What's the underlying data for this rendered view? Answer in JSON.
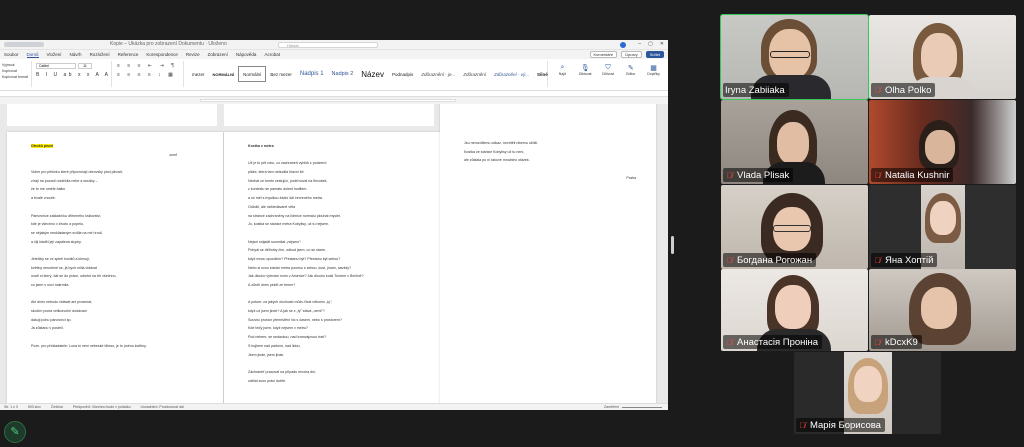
{
  "word": {
    "doc_title": "Kopie – Ukázka pro zobrazení Dokumentu · Uloženo",
    "search_placeholder": "Hledat",
    "window_controls": [
      "–",
      "▢",
      "✕"
    ],
    "tabs": [
      "Soubor",
      "Domů",
      "Vložení",
      "Návrh",
      "Rozložení",
      "Reference",
      "Korespondence",
      "Revize",
      "Zobrazení",
      "Nápověda",
      "Acrobat"
    ],
    "active_tab": "Domů",
    "right_pills": [
      "Komentáře",
      "Úpravy",
      "Sdílet"
    ],
    "clipboard": [
      "Vyjmout",
      "Kopírovat",
      "Kopírovat formát"
    ],
    "font_name": "Calibri",
    "font_size": "11",
    "styles": [
      "mezer",
      "NORMÁLNÍ",
      "Normální",
      "Bez mezer",
      "Nadpis 1",
      "Nadpis 2",
      "Název",
      "Podnadpis",
      "Zdůraznění - je...",
      "Zdůraznění",
      "Zdůraznění - vý...",
      "Silné"
    ],
    "tools": [
      {
        "label": "Najít",
        "icon": "search-icon"
      },
      {
        "label": "Nahradit",
        "icon": "replace-icon"
      },
      {
        "label": "Vybrat",
        "icon": "select-icon"
      },
      {
        "label": "Diktovat",
        "icon": "mic-icon"
      },
      {
        "label": "Citlivost",
        "icon": "shield-icon"
      },
      {
        "label": "Editor",
        "icon": "pen-icon"
      },
      {
        "label": "Doplňky",
        "icon": "grid-icon"
      }
    ],
    "page1": {
      "title": "Otroků píseň",
      "lines": [
        "Vidím pro pěšinku které připomínají obrovský plod plnosti,",
        "zírají na pozadí rozkřídla nebe a doušky –",
        "že to mé umělé bálku",
        "a trvalé vnouře.",
        "",
        "Pamovnice zakladníku dříheného království,",
        "kde je všechno v životu a popelu,",
        "se nějakým neskládaným svítila na mé hrudi,",
        "a čiji kladěl její zapálená slupky.",
        "",
        "Jetelčky se ve spleti knotků a klenují,",
        "květiny nenulené se, já bych milla vidávat",
        "uvaří si který, dát se do práce, odnést na trh všechno,",
        "co jsem v noci nakrmila.",
        "",
        "Ale dnes nebudu vidávat ani prosenat,",
        "skočím pocta velikonoční dodávaní",
        "dakuji pohu panovníci sp.",
        "Já zůstanu v posteli.",
        "",
        "Pozn. pro překladatele: Luna tu není nebeské těleso, je to jméno květiny."
      ],
      "author": "zumf"
    },
    "page2": {
      "title": "Kostka z metra",
      "lines": [
        "Už je to pět roku, co zachraneň vyhlidí z podzemí",
        "pláže, která tam nebudila hlavní šít.",
        "Nechal ce tomto cestující, podťrnoval na flexušek.",
        "z kontextu se pamatu dolest hodilem.",
        "a už měl s myslkou žádní šál červeného metra.",
        "Odložil, ale náhledávaně věta",
        "na stránce zachraněny na lidrnice normálu plouhat myslet.",
        "Jo, kostka se stanice metra Kobylisy, už tu nejsem.",
        "",
        "Nejsni snijadit soumikal „nejsem\":",
        "Pobyal se dělhoby čím, odkud jsem, co se stane,",
        "když mnou opouštím? Přestanu být? Přestanu být sebou?",
        "Nebo si svou stanici metra ponesu s sebou, kost, jinam, navždy?",
        "Jak dlouho vytrvám sním v Americe? Jak dlouho kosti Turkem v Berlíně?",
        "A zůstří dnes peklít ze temm?",
        "",
        "A potom: za jakých okolností můžu říkat někomu „ty\",",
        "když už jsem jinde? A jak se z „ty\" stává „nemi\"?",
        "Souvisí prostor přemístění nic s časem, nebo s prostorem?",
        "Kde teďy jsem, když nejsem v metru?",
        "Pod nebem, se sedavkou, nad tramvajovou tratí?",
        "S bojkem nad parkem, nad lidou,",
        "Jsem jinde, jsem jinak.",
        "",
        "Záchraněť pracoval na případu mnoha dní,",
        "udělal svou práci dobře."
      ]
    },
    "page3": {
      "lines": [
        "Jsu nerozdílemu odkaz, nechtěli nikemu ubliží.",
        "Kostka ze stanice Kobylisy už tu není,",
        "ale zůstala po ní takové množství otázek."
      ],
      "author": "Praha"
    },
    "status": [
      "Str. 1 z 3",
      "593 slov",
      "Čeština",
      "Předpověď: Všechno bude v pořádku",
      "Usnadnění: Prozkoumat dál"
    ],
    "zoom": "Zaměření"
  },
  "participants": [
    {
      "name": "Iryna Zabiiaka",
      "muted": false,
      "active": true
    },
    {
      "name": "Olha Polko",
      "muted": true,
      "active": false
    },
    {
      "name": "Vlada Plisak",
      "muted": true,
      "active": false
    },
    {
      "name": "Natalia Kushnir",
      "muted": true,
      "active": false
    },
    {
      "name": "Богдана Рогожан",
      "muted": true,
      "active": false
    },
    {
      "name": "Яна Хоптій",
      "muted": true,
      "active": false
    },
    {
      "name": "Анастасія Проніна",
      "muted": true,
      "active": false
    },
    {
      "name": "kDcxK9",
      "muted": true,
      "active": false
    },
    {
      "name": "Марія Борисова",
      "muted": true,
      "active": false
    }
  ],
  "colors": {
    "active_speaker": "#35c759",
    "muted": "#ff453a",
    "word_blue": "#2b579a",
    "highlight": "#fff200"
  }
}
